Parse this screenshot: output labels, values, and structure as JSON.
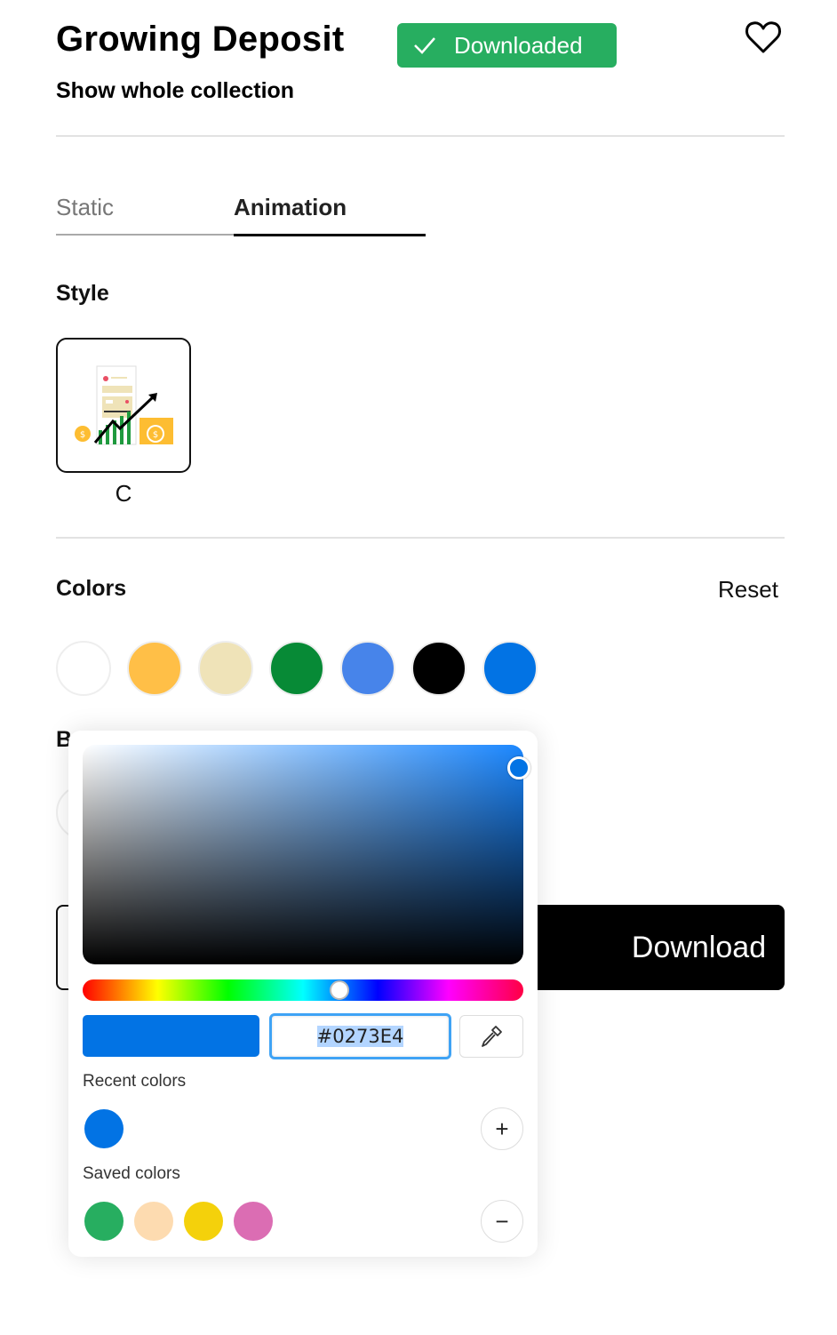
{
  "header": {
    "title": "Growing Deposit",
    "badge_label": "Downloaded",
    "badge_color": "#27ae60",
    "collection_link": "Show whole collection"
  },
  "tabs": [
    {
      "label": "Static",
      "active": false
    },
    {
      "label": "Animation",
      "active": true
    }
  ],
  "style_section": {
    "title": "Style",
    "options": [
      {
        "label": "C",
        "selected": true
      }
    ]
  },
  "colors_section": {
    "title": "Colors",
    "reset_label": "Reset",
    "swatches": [
      "#ffffff",
      "#ffbf47",
      "#efe3b8",
      "#078a36",
      "#4784ea",
      "#000000",
      "#0273e4"
    ]
  },
  "hidden_section": {
    "title_partial": "B"
  },
  "download_button": {
    "label": "Download"
  },
  "color_picker": {
    "current_color": "#0273E4",
    "hex_value": "#0273E4",
    "hue_degrees": 210,
    "recent_colors_label": "Recent colors",
    "recent_colors": [
      "#0273e4"
    ],
    "add_label": "+",
    "saved_colors_label": "Saved colors",
    "saved_colors": [
      "#27ae60",
      "#fddbb0",
      "#f4d10b",
      "#db6db3"
    ],
    "remove_label": "−"
  }
}
